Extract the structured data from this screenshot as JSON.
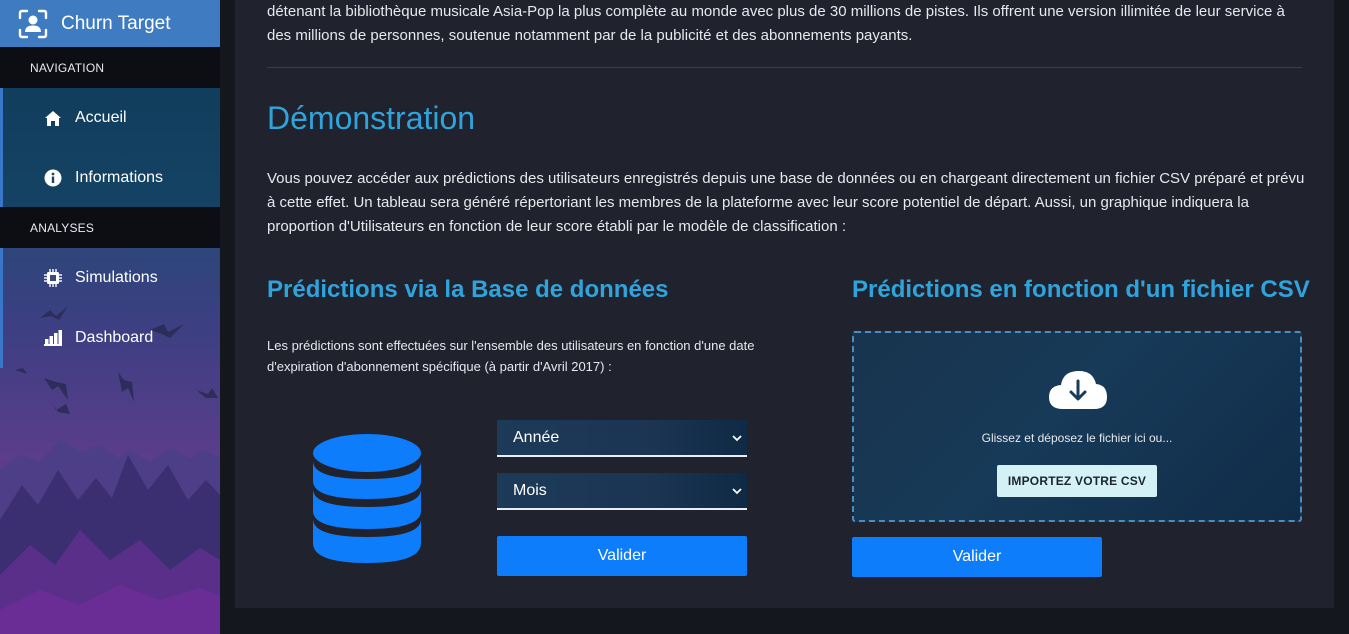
{
  "app": {
    "title": "Churn Target"
  },
  "sidebar": {
    "sections": [
      {
        "header": "NAVIGATION",
        "items": [
          {
            "label": "Accueil",
            "icon": "home-icon"
          },
          {
            "label": "Informations",
            "icon": "info-icon"
          }
        ]
      },
      {
        "header": "ANALYSES",
        "items": [
          {
            "label": "Simulations",
            "icon": "chip-icon"
          },
          {
            "label": "Dashboard",
            "icon": "bar-chart-icon"
          }
        ]
      }
    ]
  },
  "main": {
    "intro": "détenant la bibliothèque musicale Asia-Pop la plus complète au monde avec plus de 30 millions de pistes. Ils offrent une version illimitée de leur service à des millions de personnes, soutenue notamment par de la publicité et des abonnements payants.",
    "section_title": "Démonstration",
    "section_desc": "Vous pouvez accéder aux prédictions des utilisateurs enregistrés depuis une base de données ou en chargeant directement un fichier CSV préparé et prévu à cette effet. Un tableau sera généré répertoriant les membres de la plateforme avec leur score potentiel de départ. Aussi, un graphique indiquera la proportion d'Utilisateurs en fonction de leur score établi par le modèle de classification :",
    "db": {
      "title": "Prédictions via la Base de données",
      "desc": "Les prédictions sont effectuées sur l'ensemble des utilisateurs en fonction d'une date d'expiration d'abonnement spécifique (à partir d'Avril 2017) :",
      "year_select": "Année",
      "month_select": "Mois",
      "submit": "Valider"
    },
    "csv": {
      "title": "Prédictions en fonction d'un fichier CSV",
      "drop_text": "Glissez et déposez le fichier ici ou...",
      "import_button": "IMPORTEZ VOTRE CSV",
      "submit": "Valider"
    }
  },
  "colors": {
    "accent": "#2fa4dc",
    "primary_button": "#0d7dfb",
    "brand_bar": "#3f7bc0",
    "panel_bg": "#20222e",
    "page_bg": "#15171e"
  }
}
